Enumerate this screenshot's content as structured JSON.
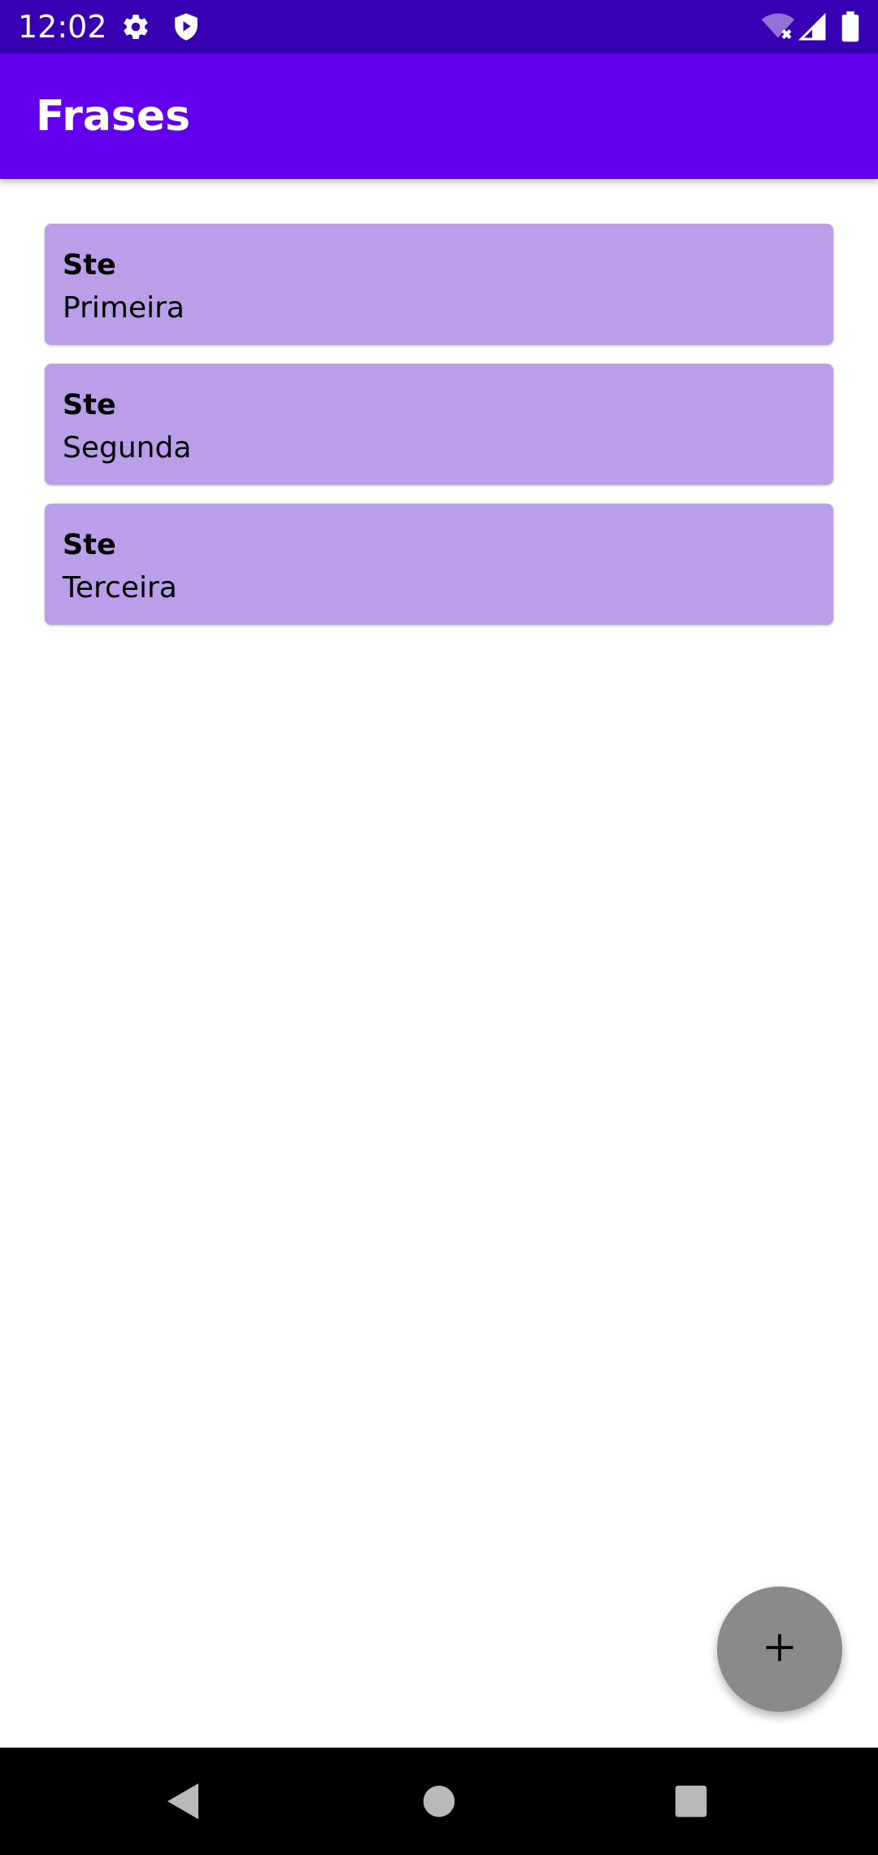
{
  "status_bar": {
    "time": "12:02",
    "icons": [
      "settings-icon",
      "shield-icon",
      "wifi-icon",
      "signal-icon",
      "battery-icon"
    ],
    "background": "#3700b3"
  },
  "app_bar": {
    "title": "Frases",
    "background": "#6200ee"
  },
  "list": {
    "card_color": "#bb9eea",
    "items": [
      {
        "title": "Ste",
        "text": "Primeira"
      },
      {
        "title": "Ste",
        "text": "Segunda"
      },
      {
        "title": "Ste",
        "text": "Terceira"
      }
    ]
  },
  "fab": {
    "icon": "plus-icon",
    "color": "#8a8a8a"
  },
  "nav_bar": {
    "buttons": [
      "back-icon",
      "home-icon",
      "recents-icon"
    ]
  }
}
